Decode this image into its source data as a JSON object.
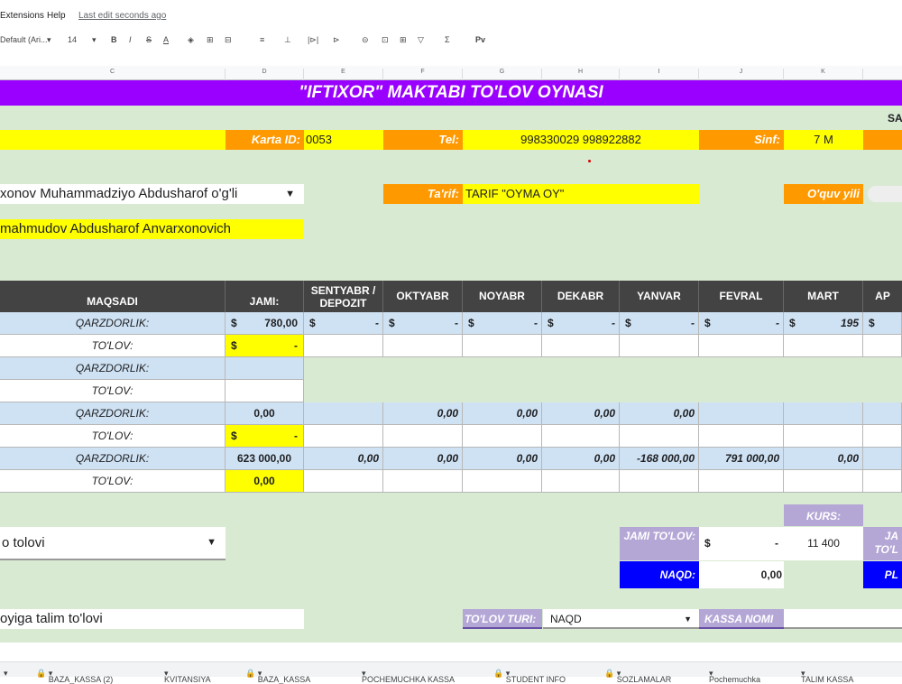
{
  "menubar": {
    "extensions": "Extensions",
    "help": "Help",
    "last_edit": "Last edit seconds ago"
  },
  "toolbar": {
    "font": "Default (Ari...",
    "size": "14",
    "bold": "B",
    "italic": "I",
    "strike": "S",
    "underline": "A",
    "fx": "Σ",
    "py": "Pv"
  },
  "columns": [
    "C",
    "D",
    "E",
    "F",
    "G",
    "H",
    "I",
    "J",
    "K"
  ],
  "banner": "\"IFTIXOR\" MAKTABI TO'LOV OYNASI",
  "sa_label": "SA",
  "karta_label": "Karta ID:",
  "karta_value": "0053",
  "tel_label": "Tel:",
  "tel_value": "998330029 998922882",
  "sinf_label": "Sinf:",
  "sinf_value": "7 M",
  "student_name": "xonov Muhammadziyo Abdusharof o'g'li",
  "parent_name": "mahmudov Abdusharof Anvarxonovich",
  "tarif_label": "Ta'rif:",
  "tarif_value": "TARIF \"OYMA OY\"",
  "oquv_label": "O'quv yili",
  "table": {
    "headers": [
      "MAQSADI",
      "JAMI:",
      "SENTYABR / DEPOZIT",
      "OKTYABR",
      "NOYABR",
      "DEKABR",
      "YANVAR",
      "FEVRAL",
      "MART",
      "AP"
    ],
    "rows": [
      {
        "label": "QARZDORLIK:",
        "jami": "780,00",
        "cells": [
          "-",
          "-",
          "-",
          "-",
          "-",
          "-",
          "195"
        ],
        "dollar": true
      },
      {
        "label": "TO'LOV:",
        "jami": "-",
        "jami_yellow": true,
        "dollar_jami": true
      },
      {
        "label": "QARZDORLIK:"
      },
      {
        "label": "TO'LOV:"
      },
      {
        "label": "QARZDORLIK:",
        "jami": "0,00",
        "cells": [
          "",
          "0,00",
          "0,00",
          "0,00",
          "0,00",
          "",
          ""
        ]
      },
      {
        "label": "TO'LOV:",
        "jami": "-",
        "jami_yellow": true,
        "dollar_jami": true
      },
      {
        "label": "QARZDORLIK:",
        "jami": "623 000,00",
        "cells": [
          "0,00",
          "0,00",
          "0,00",
          "0,00",
          "-168 000,00",
          "791 000,00",
          "0,00"
        ]
      },
      {
        "label": "TO'LOV:",
        "jami": "0,00",
        "jami_yellow": true
      }
    ]
  },
  "payment_dropdown": "o tolovi",
  "kurs_label": "KURS:",
  "kurs_value": "11 400",
  "jami_tolov_label": "JAMI TO'LOV:",
  "jami_tolov_value": "-",
  "naqd_label": "NAQD:",
  "naqd_value": "0,00",
  "ja_label": "JA TO'L",
  "pl_label": "PL",
  "purpose": "oyiga talim to'lovi",
  "tolov_turi_label": "TO'LOV TURI:",
  "tolov_turi_value": "NAQD",
  "kassa_label": "KASSA  NOMI",
  "sheet_tabs": [
    "BAZA_KASSA (2)",
    "KVITANSIYA",
    "BAZA_KASSA",
    "POCHEMUCHKA KASSA",
    "STUDENT INFO",
    "SOZLAMALAR",
    "Pochemuchka",
    "TALIM KASSA"
  ],
  "colors": {
    "banner": "#9900ff",
    "yellow": "#ffff00",
    "orange": "#ff9900",
    "lightblue": "#cfe2f3",
    "green": "#d9ead3",
    "lavender": "#b4a7d6",
    "blue": "#0000ff"
  }
}
